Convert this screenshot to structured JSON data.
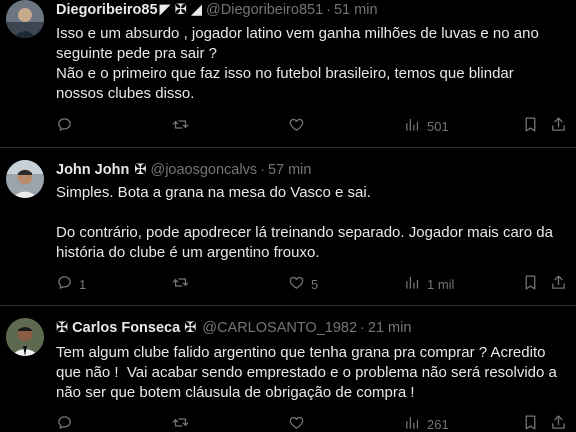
{
  "tweets": [
    {
      "name": "Diegoribeiro85",
      "flags": "◤ ✠ ◢",
      "handle": "@Diegoribeiro851",
      "dot": "·",
      "time": "51 min",
      "text": "Isso e um absurdo , jogador latino vem ganha milhões de luvas e no ano\nseguinte pede pra sair ?\nNão e o primeiro que faz isso no futebol brasileiro, temos que blindar\nnossos clubes disso.",
      "replies": "",
      "retweets": "",
      "likes": "",
      "views": "501"
    },
    {
      "name": "John John",
      "flags": "✠",
      "handle": "@joaosgoncalvs",
      "dot": "·",
      "time": "57 min",
      "text": "Simples. Bota a grana na mesa do Vasco e sai.\n\nDo contrário, pode apodrecer lá treinando separado. Jogador mais caro da\nhistória do clube é um argentino frouxo.",
      "replies": "1",
      "retweets": "",
      "likes": "5",
      "views": "1 mil"
    },
    {
      "name": "✠ Carlos Fonseca ✠",
      "flags": "",
      "handle": "@CARLOSANTO_1982",
      "dot": "·",
      "time": "21 min",
      "text": "Tem algum clube falido argentino que tenha grana pra comprar ? Acredito\nque não !  Vai acabar sendo emprestado e o problema não será resolvido a\nnão ser que botem cláusula de obrigação de compra !",
      "replies": "",
      "retweets": "",
      "likes": "",
      "views": "261"
    }
  ],
  "more_label": "···",
  "colors": {
    "background": "#000000",
    "text": "#e7e9ea",
    "muted": "#71767b",
    "divider": "#2f3336"
  },
  "icons": [
    "reply-icon",
    "retweet-icon",
    "like-icon",
    "views-icon",
    "bookmark-icon",
    "share-icon"
  ]
}
